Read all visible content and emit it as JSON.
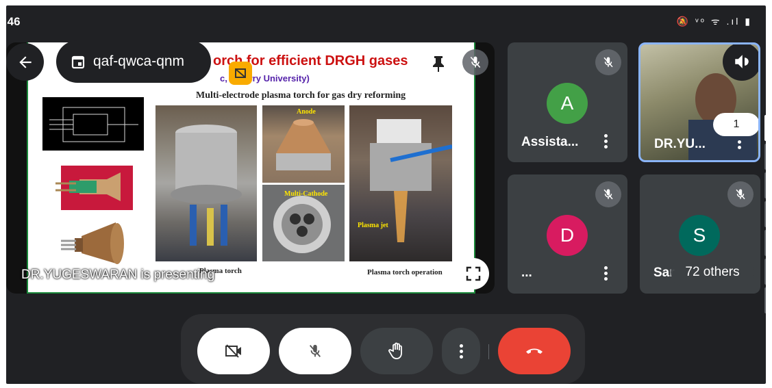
{
  "status_bar": {
    "time": ":46",
    "icons_text": "🔕 ᵛᵒ ᯤ .ıl ▮"
  },
  "meeting": {
    "code": "qaf-qwca-qnm"
  },
  "slide": {
    "title": "orch for efficient DRGH gases",
    "affiliation": "c, Pon      rry University)",
    "heading": "Multi-electrode plasma torch for gas dry reforming",
    "captions": {
      "plasma_torch": "Plasma torch",
      "plasma_torch_operation": "Plasma torch operation"
    },
    "photo_labels": {
      "anode": "Anode",
      "multi_cathode": "Multi-Cathode",
      "plasma_jet": "Plasma jet"
    }
  },
  "presenting_text": "DR.YUGESWARAN is presenting",
  "participants": [
    {
      "initial": "A",
      "name": "Assista...",
      "color": "#43a047"
    },
    {
      "initial": "",
      "name": "DR.YU...",
      "badge": "1"
    },
    {
      "initial": "D",
      "name": "...",
      "color": "#d81b60"
    },
    {
      "initial": "S",
      "name": "Sar",
      "color": "#00695c",
      "others": "72 others"
    }
  ],
  "colors": {
    "end_call": "#ea4335",
    "tile_bg": "#3c4043",
    "screen_bg": "#202124"
  }
}
